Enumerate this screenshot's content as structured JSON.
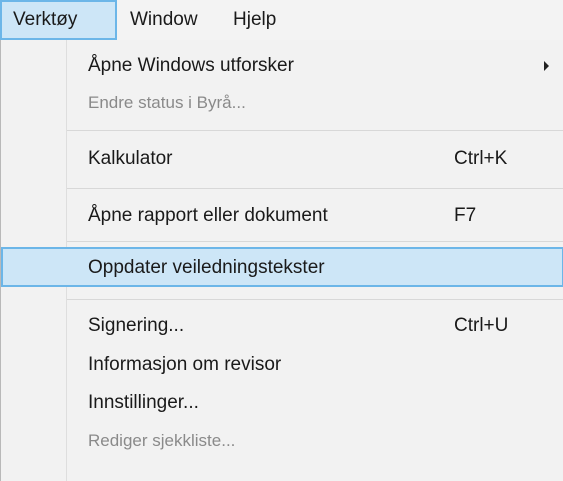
{
  "menubar": {
    "items": [
      {
        "label": "Verktøy"
      },
      {
        "label": "Window"
      },
      {
        "label": "Hjelp"
      }
    ]
  },
  "menu": {
    "items": [
      {
        "label": "Åpne Windows utforsker",
        "submenu": true
      },
      {
        "label": "Endre status i Byrå...",
        "disabled": true
      },
      {
        "label": "Kalkulator",
        "shortcut": "Ctrl+K"
      },
      {
        "label": "Åpne rapport eller dokument",
        "shortcut": "F7"
      },
      {
        "label": "Oppdater veiledningstekster",
        "highlighted": true
      },
      {
        "label": "Signering...",
        "shortcut": "Ctrl+U"
      },
      {
        "label": "Informasjon om revisor"
      },
      {
        "label": "Innstillinger..."
      },
      {
        "label": "Rediger sjekkliste...",
        "disabled": true
      }
    ]
  }
}
